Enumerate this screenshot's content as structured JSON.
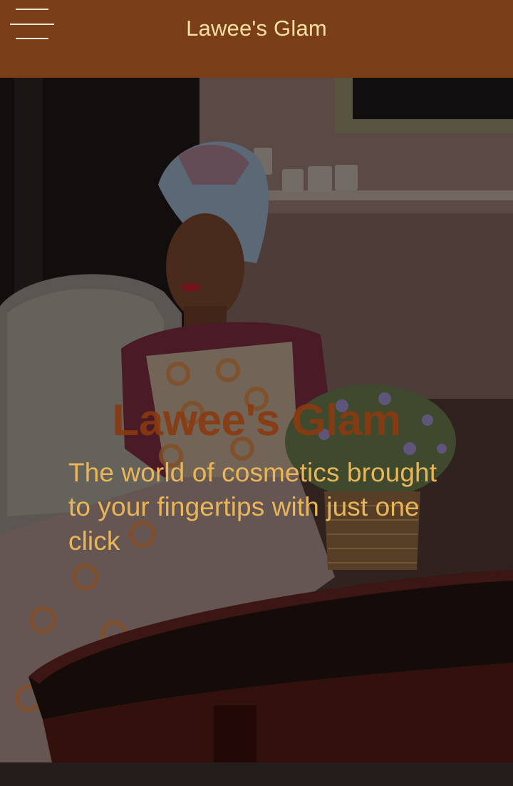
{
  "header": {
    "brand": "Lawee's Glam",
    "menu_icon": "hamburger-menu-icon"
  },
  "hero": {
    "title": "Lawee's Glam",
    "tagline": "The world of cosmetics brought to your fingertips with just one click",
    "image_alt": "photo-woman-in-ankara-outfit-seated-at-table"
  },
  "colors": {
    "header_bg": "#7a3f18",
    "brand_text": "#f6dfa3",
    "hero_title": "#8a3a10",
    "tagline": "#e8b658"
  }
}
